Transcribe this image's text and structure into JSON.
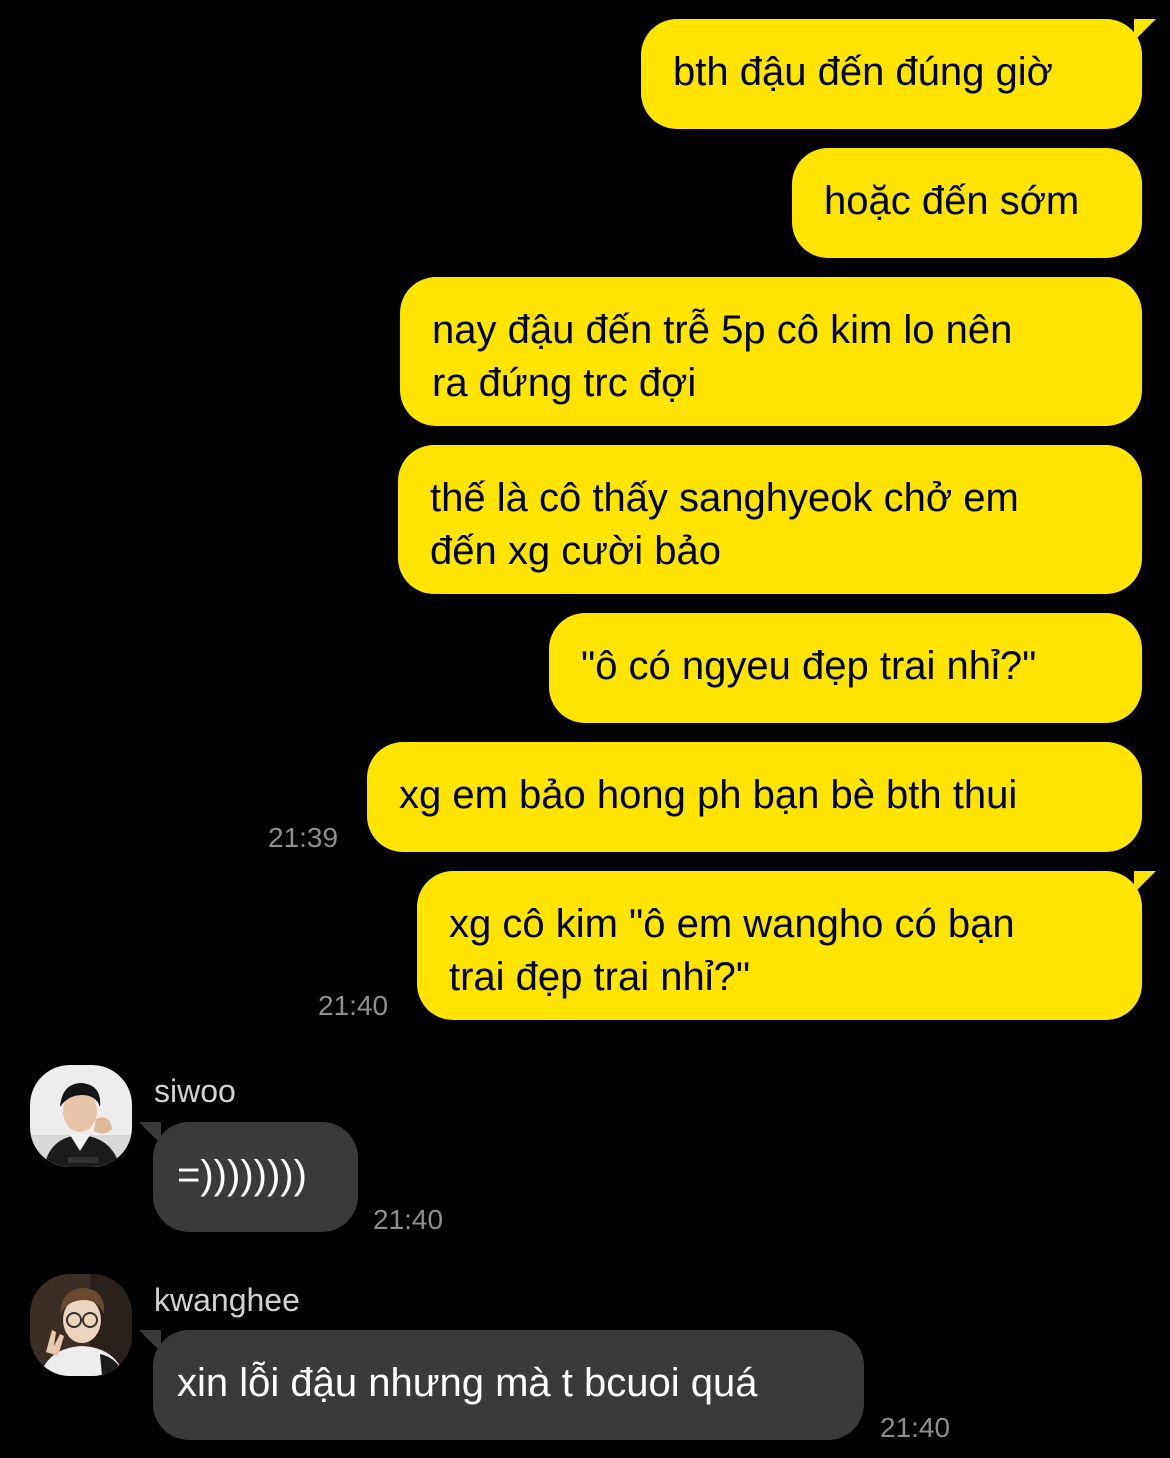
{
  "colors": {
    "background": "#000000",
    "outgoing_bubble": "#FEE500",
    "incoming_bubble": "#3A3A3C",
    "timestamp": "#8E8E93"
  },
  "messages_out": [
    {
      "text": "bth đậu đến đúng giờ"
    },
    {
      "text": "hoặc đến sớm"
    },
    {
      "text": "nay đậu đến trễ 5p cô kim lo nên\nra đứng trc đợi"
    },
    {
      "text": "thế là cô thấy sanghyeok chở em\nđến xg cười bảo"
    },
    {
      "text": "\"ô có ngyeu đẹp trai nhỉ?\""
    },
    {
      "text": "xg em bảo hong ph bạn bè bth thui",
      "time": "21:39"
    },
    {
      "text": "xg cô kim \"ô em wangho có bạn\ntrai đẹp trai nhỉ?\"",
      "time": "21:40"
    }
  ],
  "messages_in": [
    {
      "sender": "siwoo",
      "text": "=))))))))",
      "time": "21:40",
      "avatar": "siwoo-avatar"
    },
    {
      "sender": "kwanghee",
      "text": "xin lỗi đậu nhưng mà t bcuoi quá",
      "time": "21:40",
      "avatar": "kwanghee-avatar"
    }
  ]
}
